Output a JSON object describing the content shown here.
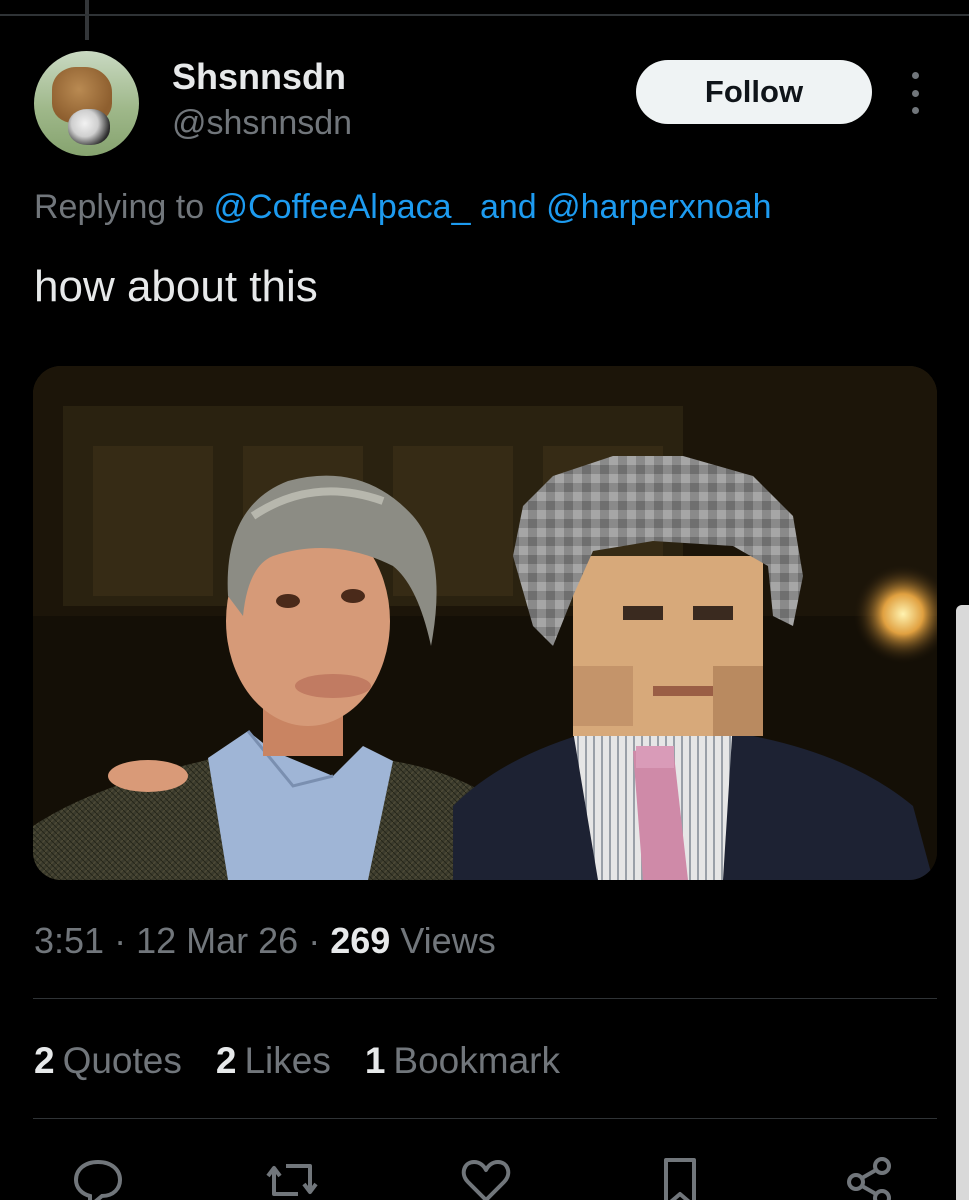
{
  "tweet": {
    "author": {
      "display_name": "Shsnnsdn",
      "handle": "@shsnnsdn",
      "avatar_icon": "avatar-alpaca-and-cat"
    },
    "follow_label": "Follow",
    "more_icon": "more-options-icon",
    "replying_prefix": "Replying to ",
    "replying_mention_1": "@CoffeeAlpaca_",
    "replying_and": " and ",
    "replying_mention_2": "@harperxnoah",
    "text": "how about this",
    "media": {
      "kind": "photo",
      "left_figure": "man with gray hair in blue shirt and tweed jacket, smiling",
      "right_figure": "pixel-art man with gray hair, pink tie, dark suit"
    },
    "time": "3:51",
    "sep": "·",
    "date": "12 Mar 26",
    "views_count": "269",
    "views_label": " Views",
    "stats": {
      "quotes_count": "2",
      "quotes_label": "Quotes",
      "likes_count": "2",
      "likes_label": "Likes",
      "bookmarks_count": "1",
      "bookmarks_label": "Bookmark"
    },
    "actions": [
      "reply-icon",
      "retweet-icon",
      "like-icon",
      "bookmark-icon",
      "share-icon"
    ]
  },
  "colors": {
    "background": "#000000",
    "primary_text": "#e7e9ea",
    "secondary_text": "#71767b",
    "link": "#1d9bf0",
    "divider": "#2f3336",
    "follow_bg": "#eff3f4"
  }
}
